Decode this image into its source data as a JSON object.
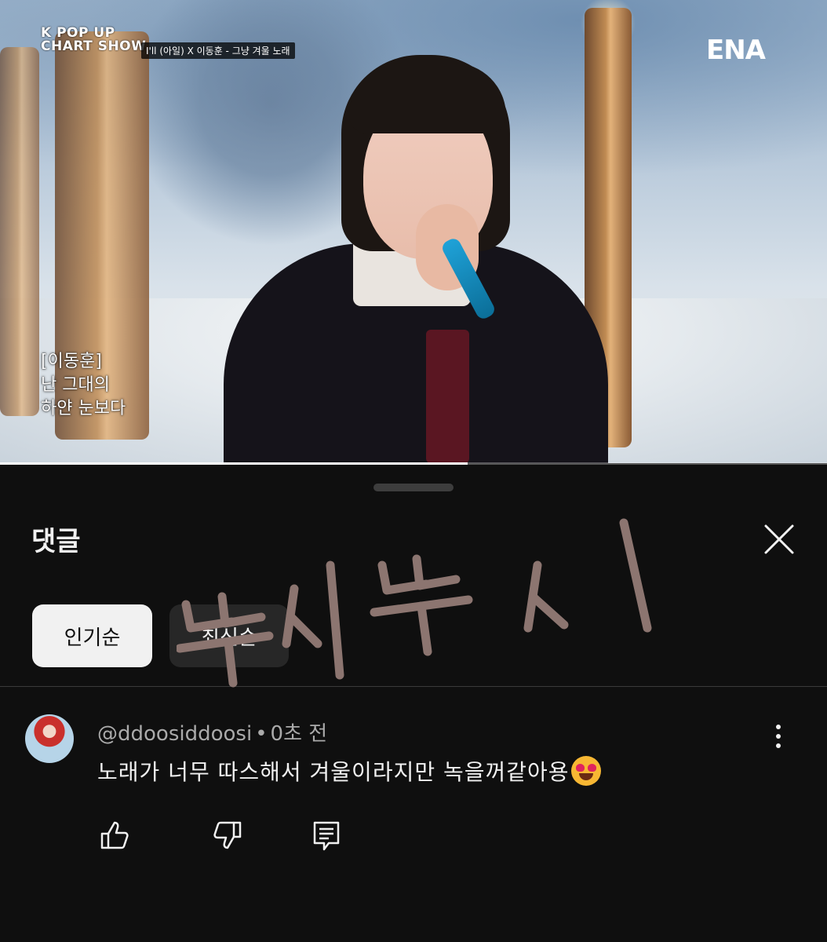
{
  "video": {
    "show_logo_line1": "K POP UP",
    "show_logo_line2": "CHART SHOW",
    "song_tag": "I'll (아일) X 이동훈 - 그냥 겨울 노래",
    "channel_logo": "ENA",
    "lyrics": [
      "[이동훈]",
      "난 그대의",
      "하얀 눈보다"
    ],
    "progress_fraction": 0.565
  },
  "comments_sheet": {
    "title": "댓글",
    "sort_chips": [
      {
        "label": "인기순",
        "selected": true
      },
      {
        "label": "최신순",
        "selected": false
      }
    ],
    "comment": {
      "author": "@ddoosiddoosi",
      "time": "0초 전",
      "text": "노래가 너무 따스해서 겨울이라지만 녹을꺼같아용",
      "emoji": "smiling-face-with-heart-eyes"
    }
  },
  "watermark": "뚜시뚜시",
  "colors": {
    "background": "#0f0f0f",
    "chip_active": "#f1f1f1",
    "chip_inactive": "#272727",
    "meta_text": "#aaaaaa",
    "watermark": "#8c7570"
  }
}
